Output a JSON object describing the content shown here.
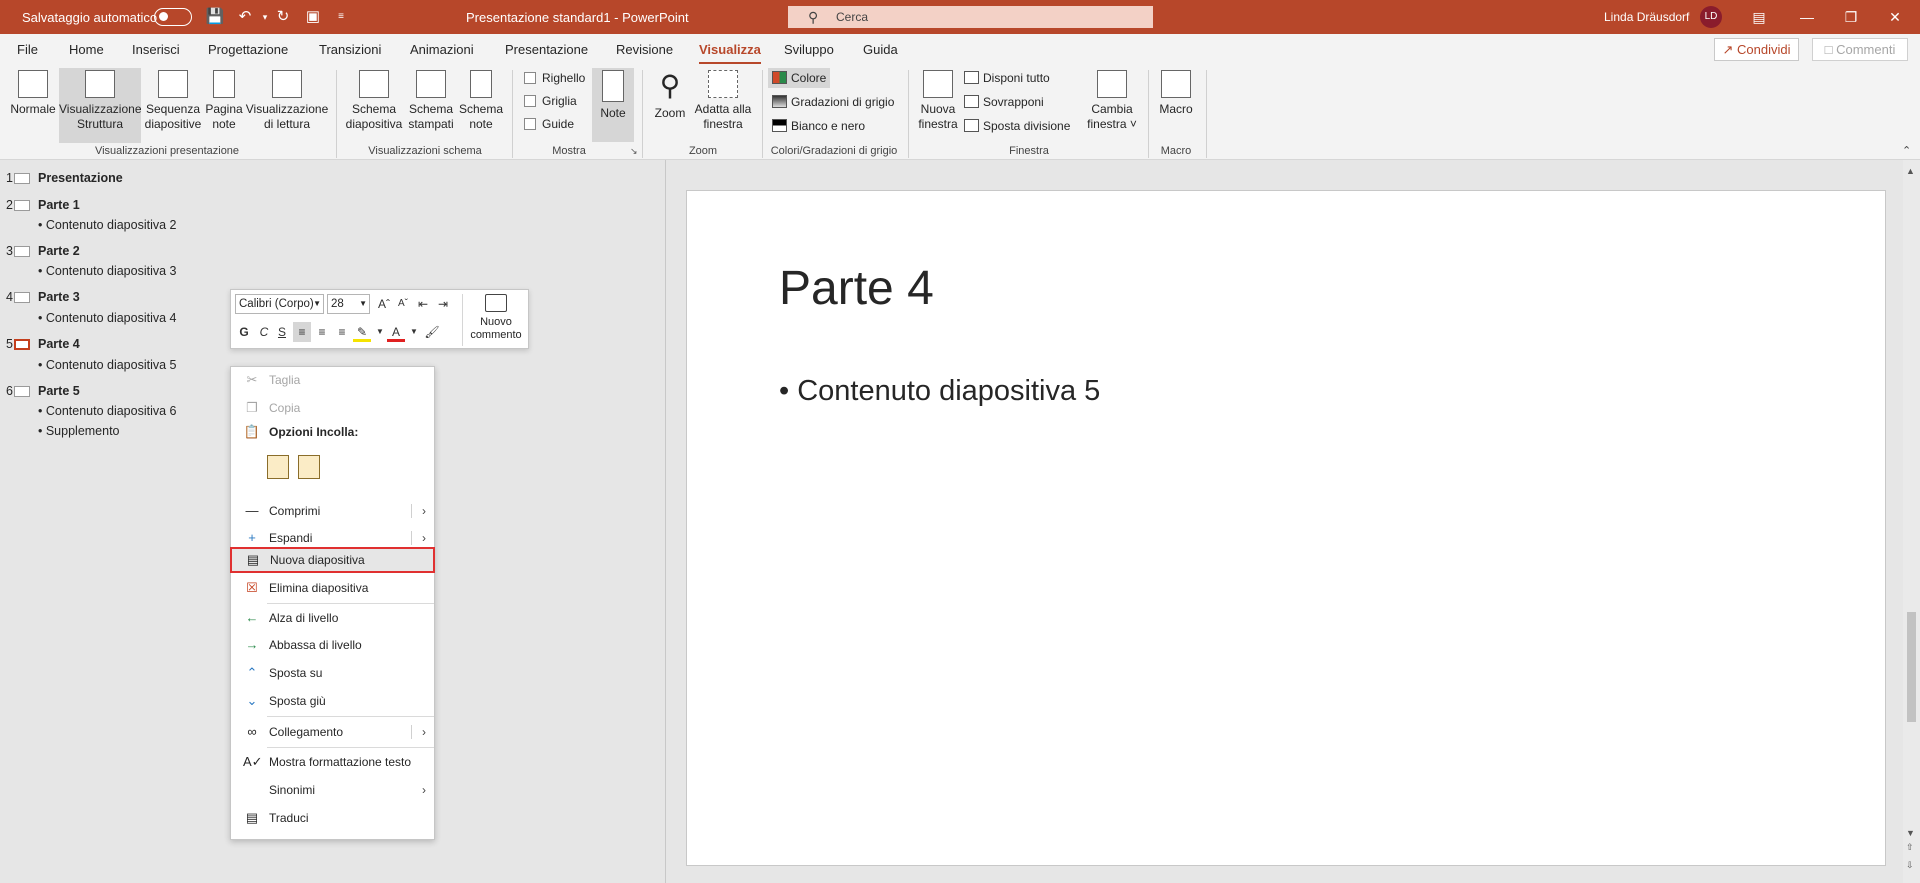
{
  "titlebar": {
    "autosave_label": "Salvataggio automatico",
    "doc_title": "Presentazione standard1  -  PowerPoint",
    "search_placeholder": "Cerca",
    "user_name": "Linda Dräusdorf",
    "user_initials": "LD"
  },
  "tabs": [
    "File",
    "Home",
    "Inserisci",
    "Progettazione",
    "Transizioni",
    "Animazioni",
    "Presentazione",
    "Revisione",
    "Visualizza",
    "Sviluppo",
    "Guida"
  ],
  "active_tab": "Visualizza",
  "share_label": "Condividi",
  "comments_label": "Commenti",
  "ribbon": {
    "presentation_views": {
      "label": "Visualizzazioni presentazione",
      "normale": "Normale",
      "struttura_1": "Visualizzazione",
      "struttura_2": "Struttura",
      "sequenza_1": "Sequenza",
      "sequenza_2": "diapositive",
      "pagina_1": "Pagina",
      "pagina_2": "note",
      "lettura_1": "Visualizzazione",
      "lettura_2": "di lettura"
    },
    "master_views": {
      "label": "Visualizzazioni schema",
      "sd_1": "Schema",
      "sd_2": "diapositiva",
      "ss_1": "Schema",
      "ss_2": "stampati",
      "sn_1": "Schema",
      "sn_2": "note"
    },
    "show": {
      "label": "Mostra",
      "righello": "Righello",
      "griglia": "Griglia",
      "guide": "Guide",
      "note": "Note"
    },
    "zoom": {
      "label": "Zoom",
      "zoom": "Zoom",
      "adatta_1": "Adatta alla",
      "adatta_2": "finestra"
    },
    "color": {
      "label": "Colori/Gradazioni di grigio",
      "colore": "Colore",
      "grigio": "Gradazioni di grigio",
      "bn": "Bianco e nero"
    },
    "window": {
      "label": "Finestra",
      "nuova_1": "Nuova",
      "nuova_2": "finestra",
      "disponi": "Disponi tutto",
      "sovrapponi": "Sovrapponi",
      "sposta": "Sposta divisione",
      "cambia_1": "Cambia",
      "cambia_2": "finestra ˅"
    },
    "macro": {
      "label": "Macro",
      "macro": "Macro"
    }
  },
  "outline": [
    {
      "num": "1",
      "title": "Presentazione",
      "bullets": []
    },
    {
      "num": "2",
      "title": "Parte 1",
      "bullets": [
        "• Contenuto diapositiva 2"
      ]
    },
    {
      "num": "3",
      "title": "Parte 2",
      "bullets": [
        "• Contenuto diapositiva 3"
      ]
    },
    {
      "num": "4",
      "title": "Parte 3",
      "bullets": [
        "• Contenuto diapositiva 4"
      ]
    },
    {
      "num": "5",
      "title": "Parte 4",
      "bullets": [
        "• Contenuto diapositiva 5"
      ]
    },
    {
      "num": "6",
      "title": "Parte 5",
      "bullets": [
        "• Contenuto diapositiva 6",
        "• Supplemento"
      ]
    }
  ],
  "slide": {
    "title": "Parte 4",
    "bullet": "• Contenuto diapositiva 5"
  },
  "minibar": {
    "font": "Calibri (Corpo)",
    "size": "28",
    "bold": "G",
    "italic": "C",
    "underline": "S",
    "new_comment_1": "Nuovo",
    "new_comment_2": "commento"
  },
  "context_menu": {
    "taglia": "Taglia",
    "copia": "Copia",
    "opzioni_incolla": "Opzioni Incolla:",
    "comprimi": "Comprimi",
    "espandi": "Espandi",
    "nuova": "Nuova diapositiva",
    "elimina": "Elimina diapositiva",
    "alza": "Alza di livello",
    "abbassa": "Abbassa di livello",
    "sposta_su": "Sposta su",
    "sposta_giu": "Sposta giù",
    "collegamento": "Collegamento",
    "mostra": "Mostra formattazione testo",
    "sinonimi": "Sinonimi",
    "traduci": "Traduci"
  },
  "colors": {
    "accent": "#b7472a",
    "highlight_border": "#e03030"
  }
}
